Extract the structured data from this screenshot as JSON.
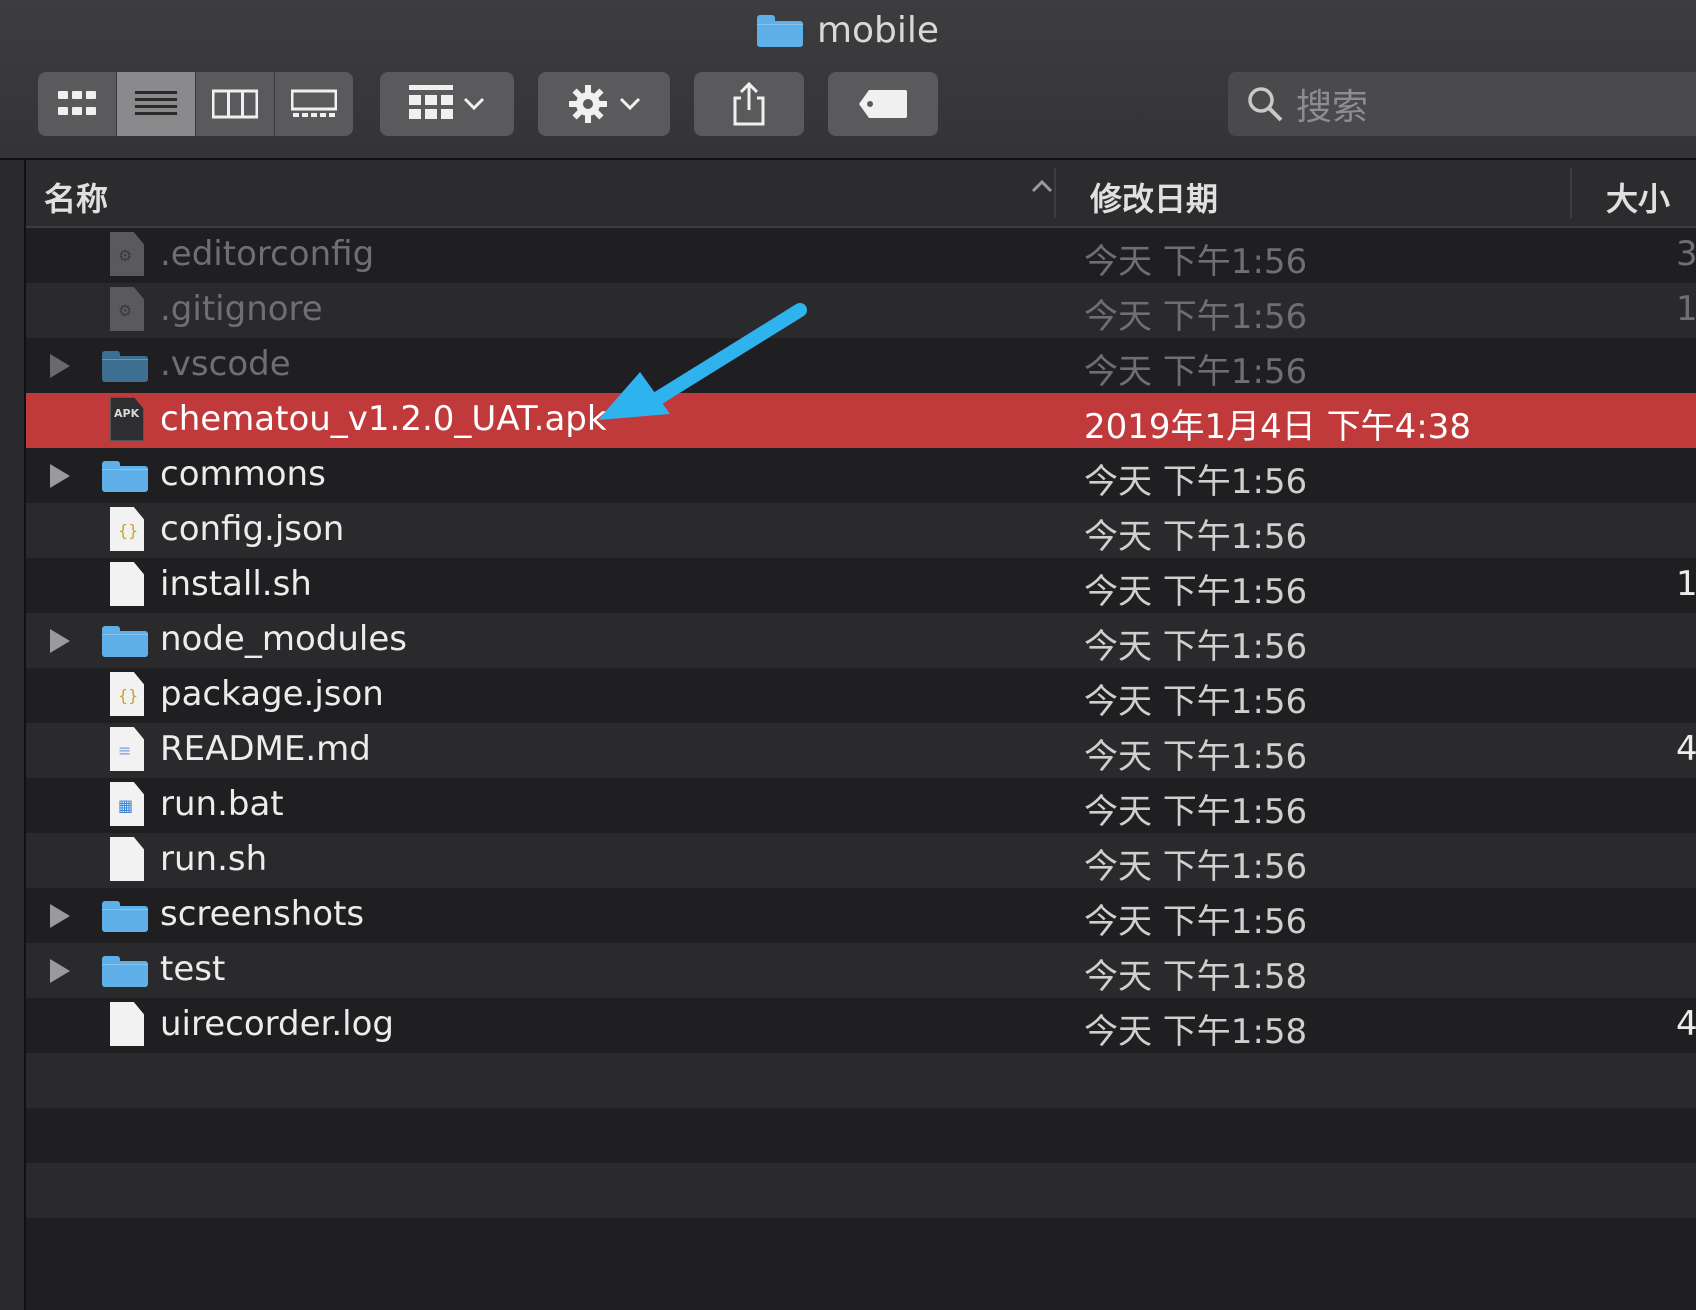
{
  "window": {
    "title": "mobile"
  },
  "toolbar": {
    "view_buttons": [
      "icon-view",
      "list-view",
      "column-view",
      "gallery-view"
    ],
    "active_view": "list-view",
    "search_placeholder": "搜索"
  },
  "columns": {
    "name": "名称",
    "date": "修改日期",
    "size": "大小"
  },
  "files": [
    {
      "name": ".editorconfig",
      "date": "今天 下午1:56",
      "size": "3",
      "kind": "doc-gear",
      "hidden": true,
      "folder": false,
      "selected": false
    },
    {
      "name": ".gitignore",
      "date": "今天 下午1:56",
      "size": "1",
      "kind": "doc-gear",
      "hidden": true,
      "folder": false,
      "selected": false
    },
    {
      "name": ".vscode",
      "date": "今天 下午1:56",
      "size": "",
      "kind": "folder",
      "hidden": true,
      "folder": true,
      "selected": false
    },
    {
      "name": "chematou_v1.2.0_UAT.apk",
      "date": "2019年1月4日 下午4:38",
      "size": "",
      "kind": "apk",
      "hidden": false,
      "folder": false,
      "selected": true
    },
    {
      "name": "commons",
      "date": "今天 下午1:56",
      "size": "",
      "kind": "folder",
      "hidden": false,
      "folder": true,
      "selected": false
    },
    {
      "name": "config.json",
      "date": "今天 下午1:56",
      "size": "",
      "kind": "json",
      "hidden": false,
      "folder": false,
      "selected": false
    },
    {
      "name": "install.sh",
      "date": "今天 下午1:56",
      "size": "1",
      "kind": "plain",
      "hidden": false,
      "folder": false,
      "selected": false
    },
    {
      "name": "node_modules",
      "date": "今天 下午1:56",
      "size": "",
      "kind": "folder",
      "hidden": false,
      "folder": true,
      "selected": false
    },
    {
      "name": "package.json",
      "date": "今天 下午1:56",
      "size": "",
      "kind": "json",
      "hidden": false,
      "folder": false,
      "selected": false
    },
    {
      "name": "README.md",
      "date": "今天 下午1:56",
      "size": "4",
      "kind": "text",
      "hidden": false,
      "folder": false,
      "selected": false
    },
    {
      "name": "run.bat",
      "date": "今天 下午1:56",
      "size": "",
      "kind": "bat",
      "hidden": false,
      "folder": false,
      "selected": false
    },
    {
      "name": "run.sh",
      "date": "今天 下午1:56",
      "size": "",
      "kind": "plain",
      "hidden": false,
      "folder": false,
      "selected": false
    },
    {
      "name": "screenshots",
      "date": "今天 下午1:56",
      "size": "",
      "kind": "folder",
      "hidden": false,
      "folder": true,
      "selected": false
    },
    {
      "name": "test",
      "date": "今天 下午1:58",
      "size": "",
      "kind": "folder",
      "hidden": false,
      "folder": true,
      "selected": false
    },
    {
      "name": "uirecorder.log",
      "date": "今天 下午1:58",
      "size": "4",
      "kind": "plain",
      "hidden": false,
      "folder": false,
      "selected": false
    }
  ],
  "colors": {
    "selection": "#c0393b",
    "folder": "#5fb0e8",
    "annotation_arrow": "#2fb3ef"
  }
}
